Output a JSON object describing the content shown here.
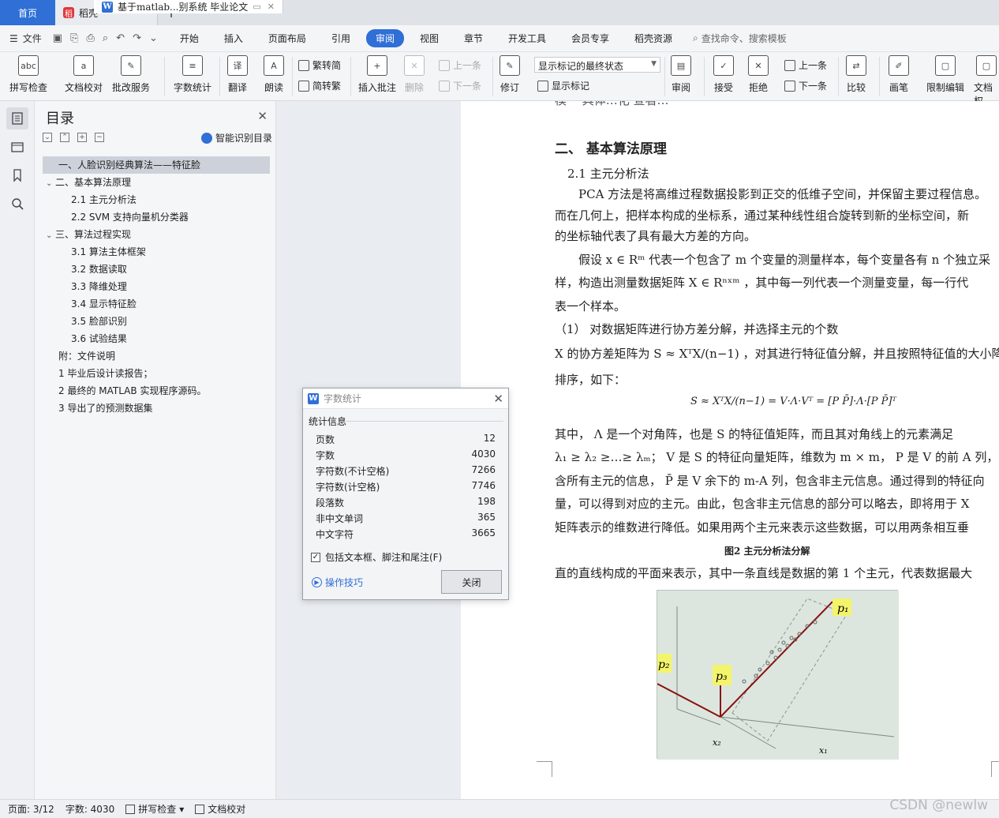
{
  "tabs": {
    "home": "首页",
    "straw": "稻壳",
    "doc": "基于matlab...别系统 毕业论文"
  },
  "menu": {
    "file": "文件",
    "items": [
      "开始",
      "插入",
      "页面布局",
      "引用",
      "审阅",
      "视图",
      "章节",
      "开发工具",
      "会员专享",
      "稻壳资源"
    ],
    "active": "审阅",
    "search": "查找命令、搜索模板"
  },
  "ribbon": {
    "spell": "拼写检查",
    "proof": "文档校对",
    "batch": "批改服务",
    "wordcount": "字数统计",
    "translate": "翻译",
    "read": "朗读",
    "trad": "繁转简",
    "simp": "简转繁",
    "insert_comment": "插入批注",
    "delete": "删除",
    "prev_comment": "上一条",
    "next_comment": "下一条",
    "revise": "修订",
    "markup_state": "显示标记的最终状态",
    "show_markup": "显示标记",
    "review": "审阅",
    "accept": "接受",
    "reject": "拒绝",
    "prev": "上一条",
    "next": "下一条",
    "compare": "比较",
    "pen": "画笔",
    "restrict": "限制编辑",
    "docperm": "文档权"
  },
  "toc": {
    "title": "目录",
    "smart": "智能识别目录",
    "items": [
      {
        "text": "一、人脸识别经典算法——特征脸",
        "level": 1
      },
      {
        "text": "二、基本算法原理",
        "level": 1
      },
      {
        "text": "2.1  主元分析法",
        "level": 2
      },
      {
        "text": "2.2 SVM 支持向量机分类器",
        "level": 2
      },
      {
        "text": "三、算法过程实现",
        "level": 1
      },
      {
        "text": "3.1  算法主体框架",
        "level": 2
      },
      {
        "text": "3.2  数据读取",
        "level": 2
      },
      {
        "text": "3.3  降维处理",
        "level": 2
      },
      {
        "text": "3.4  显示特征脸",
        "level": 2
      },
      {
        "text": "3.5  脸部识别",
        "level": 2
      },
      {
        "text": "3.6  试验结果",
        "level": 2
      },
      {
        "text": "附：文件说明",
        "level": 1
      },
      {
        "text": "1  毕业后设计读报告；",
        "level": 1
      },
      {
        "text": "2  最终的 MATLAB 实现程序源码。",
        "level": 1
      },
      {
        "text": "3  导出了的预测数据集",
        "level": 1
      }
    ]
  },
  "doc": {
    "top_fragment": "模一 具体…化 查看…",
    "heading": "二、    基本算法原理",
    "sub": "2.1 主元分析法",
    "p1a": "　　PCA 方法是将高维过程数据投影到正交的低维子空间，并保留主要过程信息。",
    "p1b": "而在几何上，把样本构成的坐标系，通过某种线性组合旋转到新的坐标空间，新",
    "p1c": "的坐标轴代表了具有最大方差的方向。",
    "p2a": "　　假设 x ∈ Rᵐ 代表一个包含了 m 个变量的测量样本，每个变量各有 n 个独立采",
    "p2b": "样，构造出测量数据矩阵  X ∈ Rⁿˣᵐ ，其中每一列代表一个测量变量，每一行代",
    "p2c": "表一个样本。",
    "p3": "（1）  对数据矩阵进行协方差分解，并选择主元的个数",
    "p4a": "X 的协方差矩阵为  S ≈ XᵀX/(n−1) ，对其进行特征值分解，并且按照特征值的大小降序",
    "p4b": "排序，如下：",
    "formula": "S ≈ XᵀX/(n−1) = V·Λ·Vᵀ = [P P̄]·Λ·[P P̄]ᵀ",
    "p5a": "其中， Λ 是一个对角阵，也是 S 的特征值矩阵，而且其对角线上的元素满足",
    "p5b": "λ₁ ≥ λ₂ ≥…≥ λₘ； V 是 S 的特征向量矩阵，维数为 m × m， P 是 V 的前 A 列，包",
    "p5c": "含所有主元的信息， P̄ 是 V 余下的 m-A 列，包含非主元信息。通过得到的特征向",
    "p5d": "量，可以得到对应的主元。由此，包含非主元信息的部分可以略去，即将用于 X",
    "p5e": "矩阵表示的维数进行降低。如果用两个主元来表示这些数据，可以用两条相互垂",
    "caption": "图2 主元分析法分解",
    "p6": "直的直线构成的平面来表示，其中一条直线是数据的第 1 个主元，代表数据最大",
    "fig_labels": {
      "p1": "p₁",
      "p2": "p₂",
      "p3": "p₃",
      "x1": "x₁",
      "x2": "x₂"
    }
  },
  "dialog": {
    "title": "字数统计",
    "group": "统计信息",
    "rows": [
      {
        "label": "页数",
        "value": "12"
      },
      {
        "label": "字数",
        "value": "4030"
      },
      {
        "label": "字符数(不计空格)",
        "value": "7266"
      },
      {
        "label": "字符数(计空格)",
        "value": "7746"
      },
      {
        "label": "段落数",
        "value": "198"
      },
      {
        "label": "非中文单词",
        "value": "365"
      },
      {
        "label": "中文字符",
        "value": "3665"
      }
    ],
    "checkbox": "包括文本框、脚注和尾注(F)",
    "tips": "操作技巧",
    "close": "关闭"
  },
  "status": {
    "page": "页面: 3/12",
    "words": "字数: 4030",
    "spell": "拼写检查",
    "proof": "文档校对"
  },
  "watermark": "CSDN @newlw"
}
